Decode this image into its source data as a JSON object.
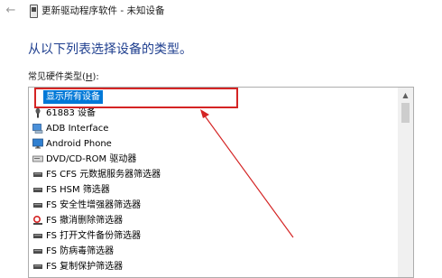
{
  "window": {
    "title": "更新驱动程序软件 - 未知设备",
    "back_icon": "back-arrow-icon"
  },
  "heading": "从以下列表选择设备的类型。",
  "list": {
    "label_text": "常见硬件类型(",
    "label_accesskey": "H",
    "label_suffix": "):",
    "items": [
      {
        "label": "显示所有设备",
        "icon": "none",
        "selected": true
      },
      {
        "label": "61883 设备",
        "icon": "firewire-device-icon"
      },
      {
        "label": "ADB Interface",
        "icon": "adb-interface-icon"
      },
      {
        "label": "Android Phone",
        "icon": "monitor-icon"
      },
      {
        "label": "DVD/CD-ROM 驱动器",
        "icon": "dvd-drive-icon"
      },
      {
        "label": "FS CFS 元数据服务器筛选器",
        "icon": "filter-driver-icon"
      },
      {
        "label": "FS HSM 筛选器",
        "icon": "filter-driver-icon"
      },
      {
        "label": "FS 安全性增强器筛选器",
        "icon": "filter-driver-icon"
      },
      {
        "label": "FS 撤消删除筛选器",
        "icon": "undelete-filter-icon"
      },
      {
        "label": "FS 打开文件备份筛选器",
        "icon": "filter-driver-icon"
      },
      {
        "label": "FS 防病毒筛选器",
        "icon": "filter-driver-icon"
      },
      {
        "label": "FS 复制保护筛选器",
        "icon": "filter-driver-icon"
      }
    ]
  },
  "colors": {
    "accent": "#0078d7",
    "heading": "#1f3f8f",
    "annotation": "#d42424"
  }
}
